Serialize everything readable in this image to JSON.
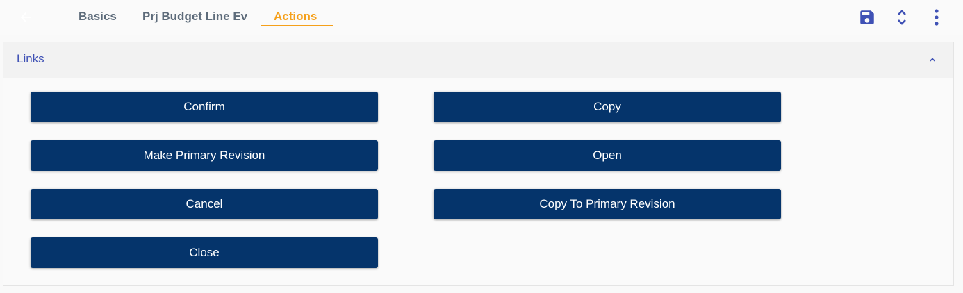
{
  "header": {
    "back_icon": "arrow-left-icon",
    "tabs": [
      {
        "label": "Basics"
      },
      {
        "label": "Prj Budget Line Ev"
      },
      {
        "label": "Actions",
        "active": true
      }
    ],
    "icons": [
      "save-icon",
      "expand-collapse-icon",
      "more-vertical-icon"
    ],
    "colors": {
      "active_tab": "#f5a01a",
      "tab": "#5d6b7a",
      "icon": "#3f51b5"
    }
  },
  "links_panel": {
    "title": "Links",
    "collapse_icon": "chevron-up-icon",
    "buttons": {
      "confirm": "Confirm",
      "copy": "Copy",
      "make_primary_revision": "Make Primary Revision",
      "open": "Open",
      "cancel": "Cancel",
      "copy_to_primary_revision": "Copy To Primary Revision",
      "close": "Close"
    },
    "colors": {
      "button_bg": "#05346b",
      "button_text": "#ffffff",
      "title": "#3f51b5"
    }
  }
}
